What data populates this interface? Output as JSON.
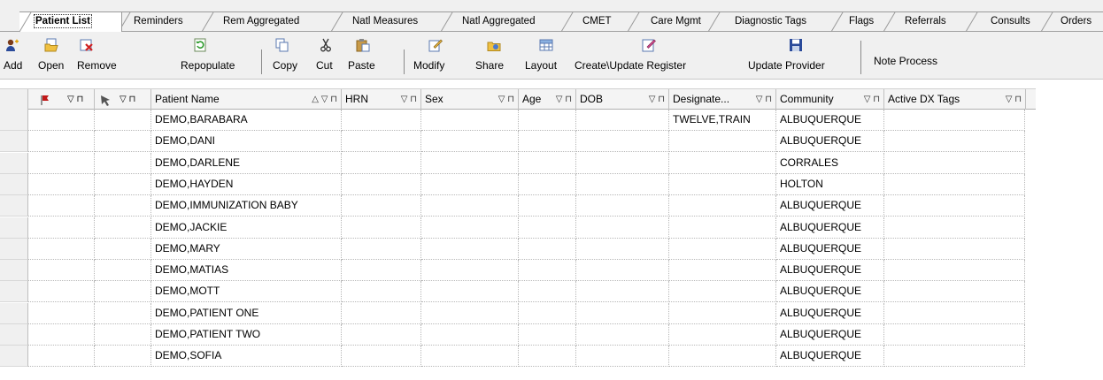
{
  "tabs": [
    {
      "label": "Patient List",
      "active": true
    },
    {
      "label": "Reminders"
    },
    {
      "label": "Rem Aggregated"
    },
    {
      "label": "Natl Measures"
    },
    {
      "label": "Natl Aggregated"
    },
    {
      "label": "CMET"
    },
    {
      "label": "Care Mgmt"
    },
    {
      "label": "Diagnostic Tags"
    },
    {
      "label": "Flags"
    },
    {
      "label": "Referrals"
    },
    {
      "label": "Consults"
    },
    {
      "label": "Orders"
    }
  ],
  "toolbar": {
    "add": "Add",
    "open": "Open",
    "remove": "Remove",
    "repopulate": "Repopulate",
    "copy": "Copy",
    "cut": "Cut",
    "paste": "Paste",
    "modify": "Modify",
    "share": "Share",
    "layout": "Layout",
    "create_update_register": "Create\\Update Register",
    "update_provider": "Update Provider",
    "note_process": "Note Process"
  },
  "grid": {
    "columns": {
      "patient_name": "Patient Name",
      "hrn": "HRN",
      "sex": "Sex",
      "age": "Age",
      "dob": "DOB",
      "designated": "Designate...",
      "community": "Community",
      "active_dx_tags": "Active DX Tags"
    },
    "rows": [
      {
        "name": "DEMO,BARABARA",
        "designated": "TWELVE,TRAIN",
        "community": "ALBUQUERQUE"
      },
      {
        "name": "DEMO,DANI",
        "designated": "",
        "community": "ALBUQUERQUE"
      },
      {
        "name": "DEMO,DARLENE",
        "designated": "",
        "community": "CORRALES"
      },
      {
        "name": "DEMO,HAYDEN",
        "designated": "",
        "community": "HOLTON"
      },
      {
        "name": "DEMO,IMMUNIZATION BABY",
        "designated": "",
        "community": "ALBUQUERQUE"
      },
      {
        "name": "DEMO,JACKIE",
        "designated": "",
        "community": "ALBUQUERQUE"
      },
      {
        "name": "DEMO,MARY",
        "designated": "",
        "community": "ALBUQUERQUE"
      },
      {
        "name": "DEMO,MATIAS",
        "designated": "",
        "community": "ALBUQUERQUE"
      },
      {
        "name": "DEMO,MOTT",
        "designated": "",
        "community": "ALBUQUERQUE"
      },
      {
        "name": "DEMO,PATIENT ONE",
        "designated": "",
        "community": "ALBUQUERQUE"
      },
      {
        "name": "DEMO,PATIENT TWO",
        "designated": "",
        "community": "ALBUQUERQUE"
      },
      {
        "name": "DEMO,SOFIA",
        "designated": "",
        "community": "ALBUQUERQUE"
      }
    ]
  }
}
